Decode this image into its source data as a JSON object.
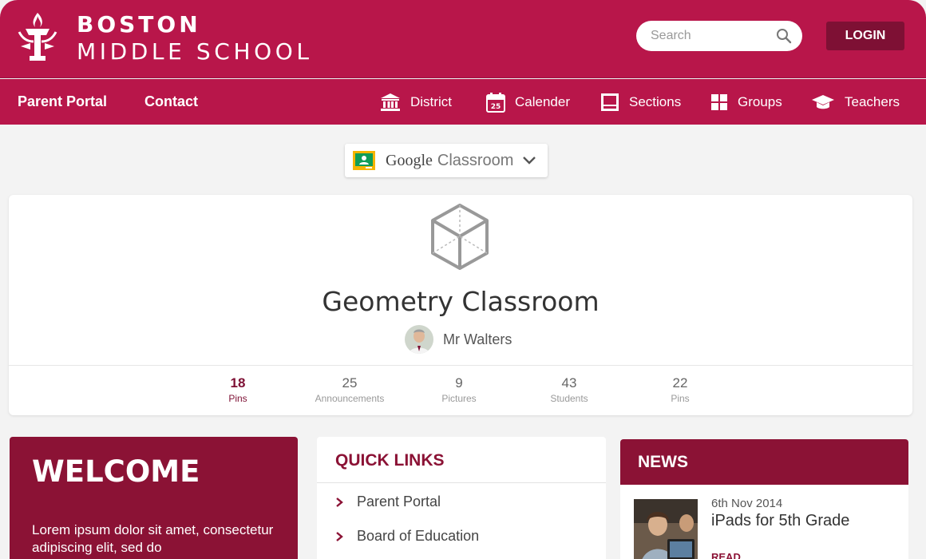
{
  "brand": {
    "line1": "BOSTON",
    "line2": "MIDDLE SCHOOL"
  },
  "search": {
    "placeholder": "Search"
  },
  "login_label": "LOGIN",
  "nav": {
    "left": [
      "Parent Portal",
      "Contact"
    ],
    "right": [
      {
        "label": "District",
        "icon": "building-icon"
      },
      {
        "label": "Calender",
        "icon": "calendar-icon"
      },
      {
        "label": "Sections",
        "icon": "sections-icon"
      },
      {
        "label": "Groups",
        "icon": "grid-icon"
      },
      {
        "label": "Teachers",
        "icon": "graduation-cap-icon"
      }
    ],
    "calendar_day": "25"
  },
  "classroom_select": {
    "brand": "Google",
    "product": "Classroom"
  },
  "classroom": {
    "title": "Geometry Classroom",
    "teacher": "Mr Walters",
    "stats": [
      {
        "value": "18",
        "label": "Pins",
        "active": true
      },
      {
        "value": "25",
        "label": "Announcements",
        "active": false
      },
      {
        "value": "9",
        "label": "Pictures",
        "active": false
      },
      {
        "value": "43",
        "label": "Students",
        "active": false
      },
      {
        "value": "22",
        "label": "Pins",
        "active": false
      }
    ]
  },
  "welcome": {
    "title": "WELCOME",
    "text": "Lorem ipsum dolor sit amet, consectetur adipiscing elit, sed do"
  },
  "quick_links": {
    "title": "QUICK LINKS",
    "items": [
      "Parent Portal",
      "Board of Education"
    ]
  },
  "news": {
    "title": "NEWS",
    "date": "6th Nov 2014",
    "headline": "iPads for 5th Grade",
    "read_label": "READ"
  },
  "colors": {
    "brand": "#b8164a",
    "brand_dark": "#8b1235",
    "background": "#f3f3f3"
  }
}
